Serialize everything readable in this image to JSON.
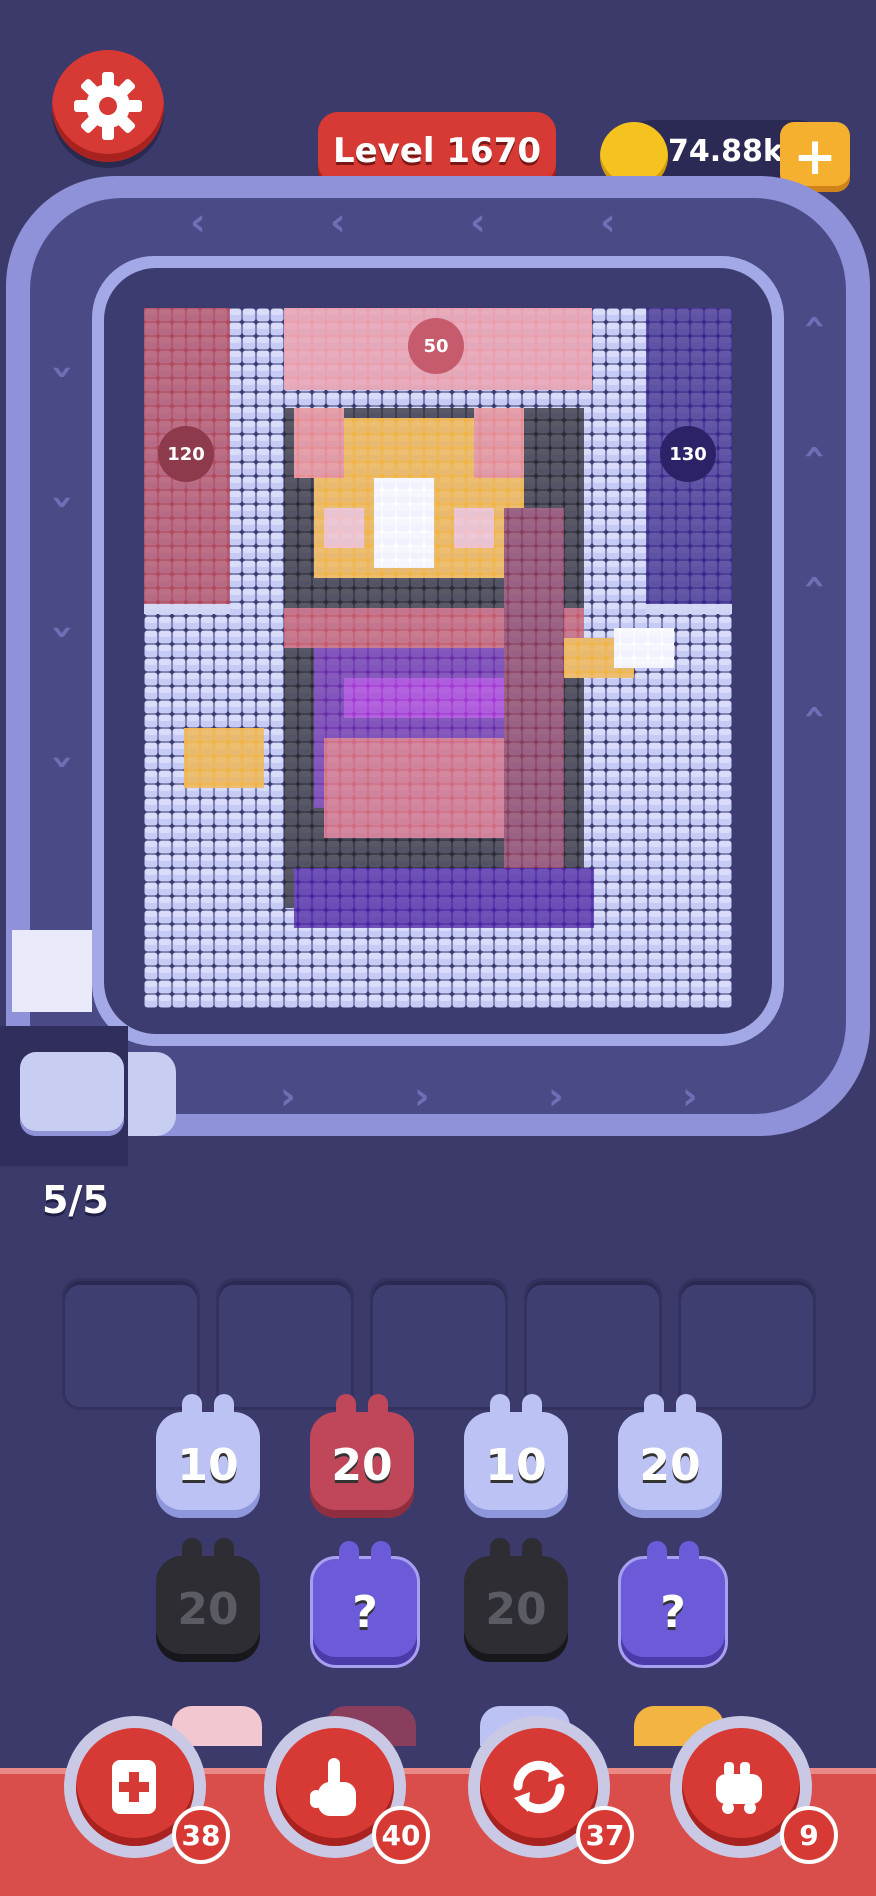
{
  "header": {
    "settings_icon": "gear-icon",
    "level_label": "Level 1670",
    "coins": "74.88k",
    "add_coins_icon": "plus-icon"
  },
  "board": {
    "top_chip": "50",
    "left_chip": "120",
    "right_chip": "130",
    "image": "pixel-art-fox-archer"
  },
  "conveyor": {
    "capacity": "5/5"
  },
  "slots": {
    "count": 5
  },
  "pieces": {
    "row1": [
      {
        "color": "blue",
        "value": "10"
      },
      {
        "color": "red",
        "value": "20"
      },
      {
        "color": "blue",
        "value": "10"
      },
      {
        "color": "blue",
        "value": "20"
      }
    ],
    "row2": [
      {
        "color": "black",
        "value": "20"
      },
      {
        "color": "mystery",
        "value": "?"
      },
      {
        "color": "black",
        "value": "20"
      },
      {
        "color": "mystery",
        "value": "?"
      }
    ]
  },
  "boosters": [
    {
      "name": "add-slot",
      "count": "38",
      "icon": "add-card-icon"
    },
    {
      "name": "pick",
      "count": "40",
      "icon": "hand-pointer-icon"
    },
    {
      "name": "shuffle",
      "count": "37",
      "icon": "shuffle-icon"
    },
    {
      "name": "train",
      "count": "9",
      "icon": "train-icon"
    }
  ],
  "colors": {
    "background": "#3b3a6a",
    "accent_red": "#d73a35",
    "coin": "#f5c320",
    "track": "#8f92d8"
  }
}
